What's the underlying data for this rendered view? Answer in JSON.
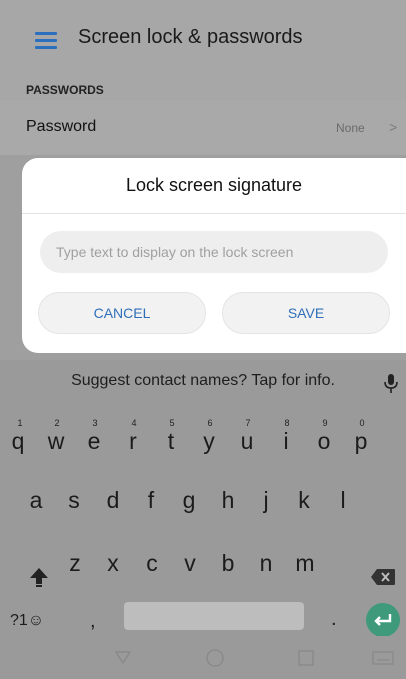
{
  "appbar": {
    "title": "Screen lock & passwords",
    "menu_icon": "hamburger-menu-icon"
  },
  "section": {
    "label": "PASSWORDS"
  },
  "password_row": {
    "label": "Password",
    "value": "None"
  },
  "dialog": {
    "title": "Lock screen signature",
    "input_placeholder": "Type text to display on the lock screen",
    "input_value": "",
    "cancel_label": "CANCEL",
    "save_label": "SAVE"
  },
  "keyboard": {
    "suggestion": "Suggest contact names? Tap for info.",
    "row1": [
      "q",
      "w",
      "e",
      "r",
      "t",
      "y",
      "u",
      "i",
      "o",
      "p"
    ],
    "row1_nums": [
      "1",
      "2",
      "3",
      "4",
      "5",
      "6",
      "7",
      "8",
      "9",
      "0"
    ],
    "row2": [
      "a",
      "s",
      "d",
      "f",
      "g",
      "h",
      "j",
      "k",
      "l"
    ],
    "row3": [
      "z",
      "x",
      "c",
      "v",
      "b",
      "n",
      "m"
    ],
    "sym_label": "?1☺",
    "comma": ",",
    "period": "."
  },
  "colors": {
    "accent": "#2f6fb9",
    "enter": "#3f9a7c",
    "scrim": "#9b9b9b"
  },
  "navbar": {
    "icons": [
      "back-triangle-icon",
      "home-circle-icon",
      "recents-square-icon",
      "keyboard-icon"
    ]
  }
}
